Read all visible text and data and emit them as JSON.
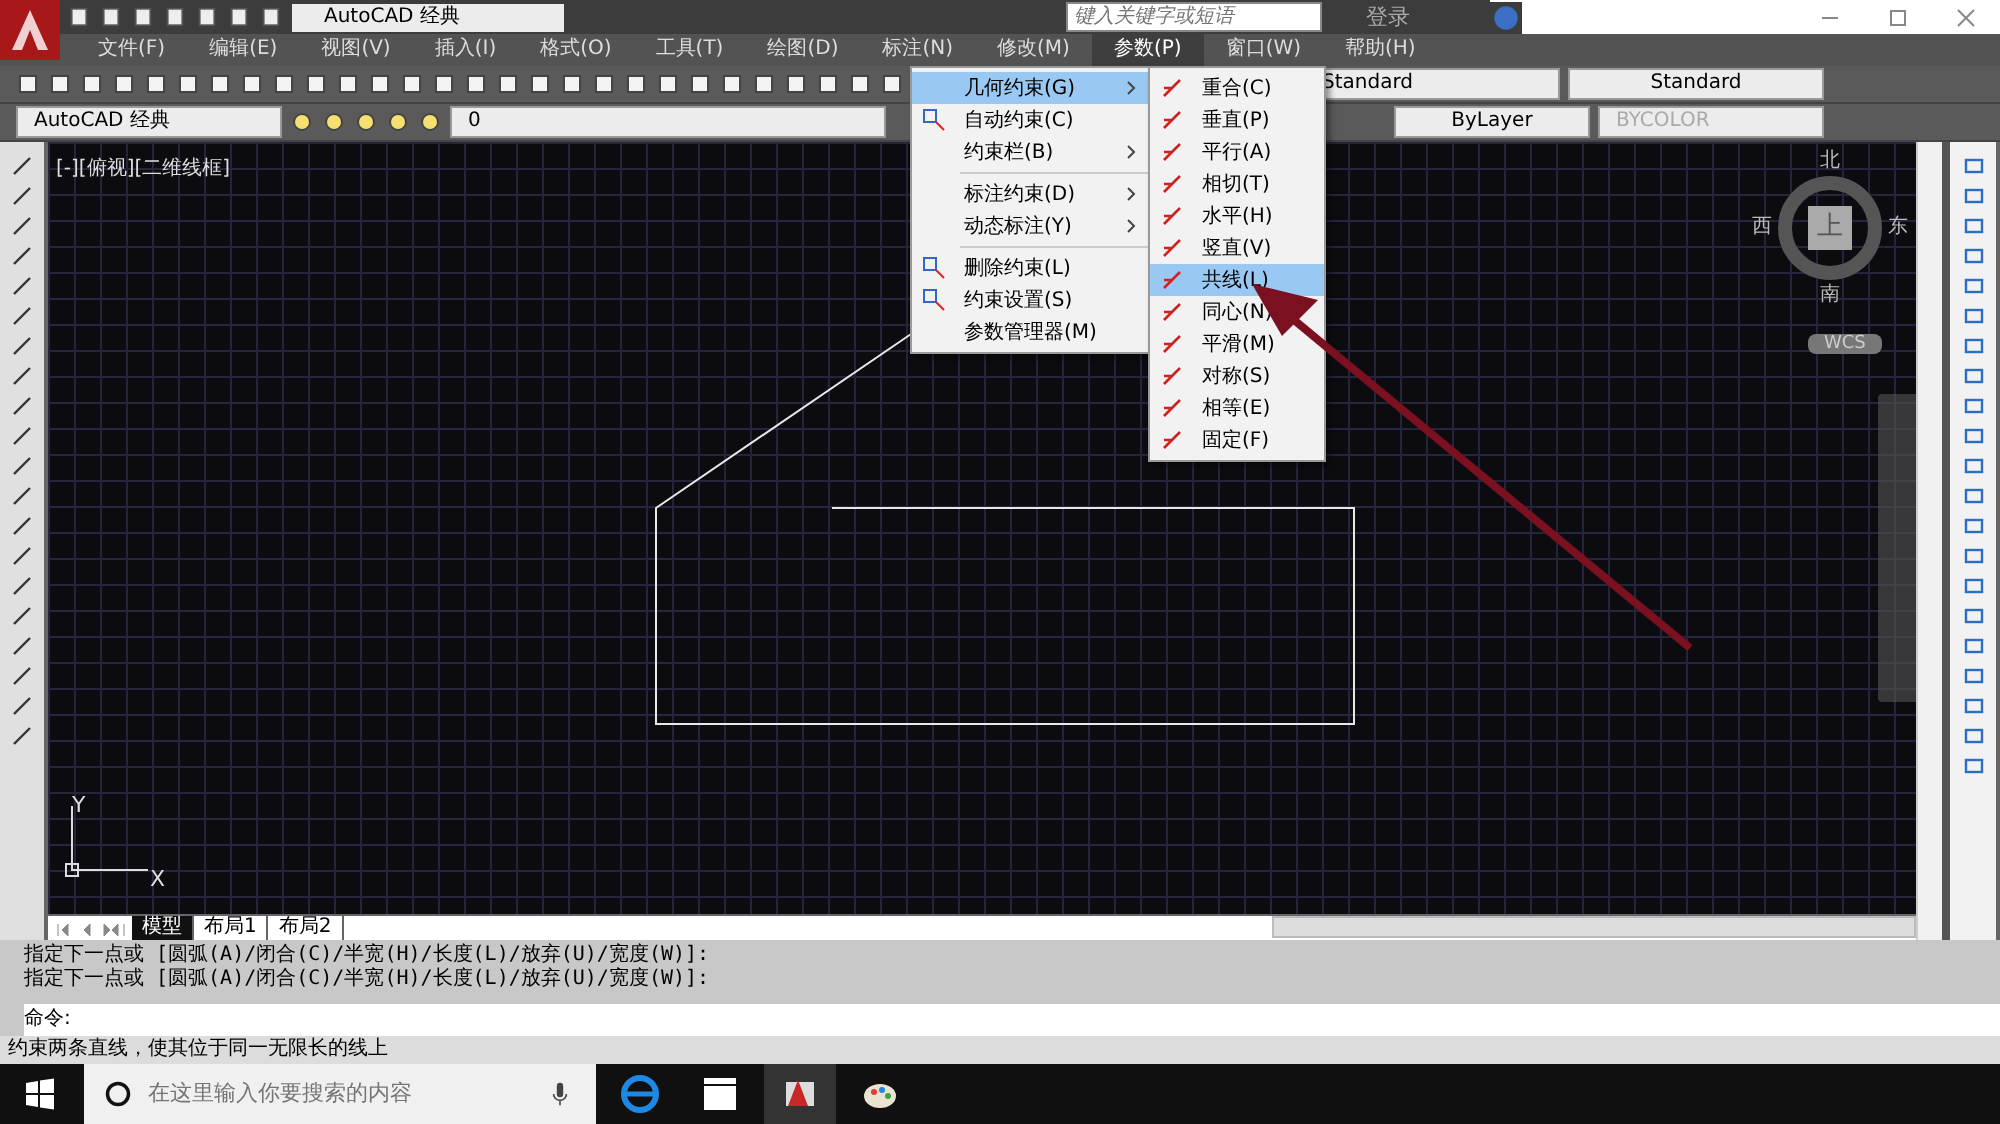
{
  "title_bar": {
    "workspace": "AutoCAD 经典",
    "search": {
      "placeholder": "键入关键字或短语"
    },
    "login": "登录"
  },
  "menu_bar": [
    {
      "label": "文件(F)",
      "selected": false
    },
    {
      "label": "编辑(E)",
      "selected": false
    },
    {
      "label": "视图(V)",
      "selected": false
    },
    {
      "label": "插入(I)",
      "selected": false
    },
    {
      "label": "格式(O)",
      "selected": false
    },
    {
      "label": "工具(T)",
      "selected": false
    },
    {
      "label": "绘图(D)",
      "selected": false
    },
    {
      "label": "标注(N)",
      "selected": false
    },
    {
      "label": "修改(M)",
      "selected": false
    },
    {
      "label": "参数(P)",
      "selected": true
    },
    {
      "label": "窗口(W)",
      "selected": false
    },
    {
      "label": "帮助(H)",
      "selected": false
    }
  ],
  "toolbar": {
    "text_style": "Standard",
    "dim_style": "Standard"
  },
  "properties_bar": {
    "workspace": "AutoCAD 经典",
    "layer": "0",
    "linetype": "ByLayer",
    "plot_style": "BYCOLOR"
  },
  "viewport": {
    "label": "[-][俯视][二维线框]",
    "viewcube": {
      "north": "北",
      "south": "南",
      "east": "东",
      "west": "西",
      "face": "上"
    },
    "ucs": "WCS",
    "axis_x": "X",
    "axis_y": "Y"
  },
  "layout_tabs": [
    {
      "label": "模型",
      "selected": true
    },
    {
      "label": "布局1",
      "selected": false
    },
    {
      "label": "布局2",
      "selected": false
    }
  ],
  "command_history": [
    "指定下一点或 [圆弧(A)/闭合(C)/半宽(H)/长度(L)/放弃(U)/宽度(W)]:",
    "指定下一点或 [圆弧(A)/闭合(C)/半宽(H)/长度(L)/放弃(U)/宽度(W)]:"
  ],
  "command_prompt": "命令:",
  "status_text": "约束两条直线，使其位于同一无限长的线上",
  "taskbar": {
    "search": {
      "placeholder": "在这里输入你要搜索的内容"
    }
  },
  "menu": {
    "groups": [
      [
        {
          "label": "几何约束(G)",
          "selected": true,
          "submenu": true
        },
        {
          "label": "自动约束(C)",
          "selected": false,
          "submenu": false
        },
        {
          "label": "约束栏(B)",
          "selected": false,
          "submenu": true
        }
      ],
      [
        {
          "label": "标注约束(D)",
          "selected": false,
          "submenu": true
        },
        {
          "label": "动态标注(Y)",
          "selected": false,
          "submenu": true
        }
      ],
      [
        {
          "label": "删除约束(L)",
          "selected": false,
          "submenu": false
        },
        {
          "label": "约束设置(S)",
          "selected": false,
          "submenu": false
        },
        {
          "label": "参数管理器(M)",
          "selected": false,
          "submenu": false
        }
      ]
    ]
  },
  "submenu": [
    {
      "label": "重合(C)",
      "selected": false
    },
    {
      "label": "垂直(P)",
      "selected": false
    },
    {
      "label": "平行(A)",
      "selected": false
    },
    {
      "label": "相切(T)",
      "selected": false
    },
    {
      "label": "水平(H)",
      "selected": false
    },
    {
      "label": "竖直(V)",
      "selected": false
    },
    {
      "label": "共线(L)",
      "selected": true
    },
    {
      "label": "同心(N)",
      "selected": false
    },
    {
      "label": "平滑(M)",
      "selected": false
    },
    {
      "label": "对称(S)",
      "selected": false
    },
    {
      "label": "相等(E)",
      "selected": false
    },
    {
      "label": "固定(F)",
      "selected": false
    }
  ]
}
